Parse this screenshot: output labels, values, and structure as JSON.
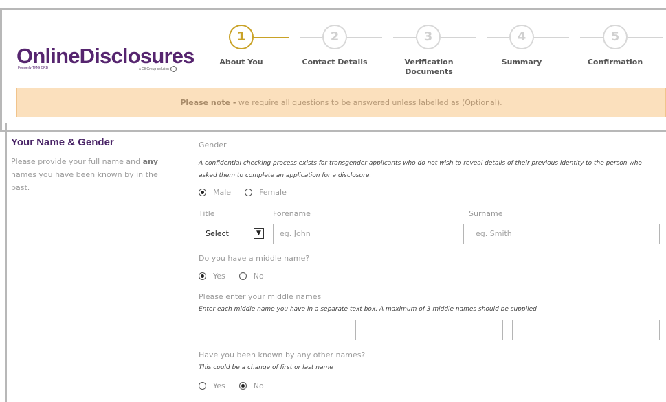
{
  "brand": {
    "name": "OnlineDisclosures",
    "formerly": "Formerly TMG CRB",
    "tagline": "a GBGroup solution"
  },
  "steps": [
    {
      "number": "1",
      "label": "About You",
      "active": true
    },
    {
      "number": "2",
      "label": "Contact Details",
      "active": false
    },
    {
      "number": "3",
      "label": "Verification Documents",
      "active": false
    },
    {
      "number": "4",
      "label": "Summary",
      "active": false
    },
    {
      "number": "5",
      "label": "Confirmation",
      "active": false
    }
  ],
  "notice": {
    "bold": "Please note -",
    "text": " we require all questions to be answered unless labelled as (Optional)."
  },
  "section": {
    "title": "Your Name & Gender",
    "desc_before": "Please provide your full name and ",
    "desc_bold": "any",
    "desc_after": " names you have been known by in the past."
  },
  "form": {
    "gender_label": "Gender",
    "gender_note": "A confidential checking process exists for transgender applicants who do not wish to reveal details of their previous identity to the person who asked them to complete an application for a disclosure.",
    "gender_options": [
      "Male",
      "Female"
    ],
    "gender_selected": "Male",
    "title_label": "Title",
    "title_value": "Select",
    "forename_label": "Forename",
    "forename_placeholder": "eg. John",
    "surname_label": "Surname",
    "surname_placeholder": "eg. Smith",
    "middle_q": "Do you have a middle name?",
    "middle_options": [
      "Yes",
      "No"
    ],
    "middle_selected": "Yes",
    "middle_names_label": "Please enter your middle names",
    "middle_names_note": "Enter each middle name you have in a separate text box. A maximum of 3 middle names should be supplied",
    "middle_inputs": [
      "",
      "",
      ""
    ],
    "other_q": "Have you been known by any other names?",
    "other_note": "This could be a change of first or last name",
    "other_options": [
      "Yes",
      "No"
    ],
    "other_selected": "No"
  },
  "colors": {
    "brand_purple": "#56256f",
    "step_active": "#c9a227",
    "notice_bg": "#fbe0bd"
  }
}
